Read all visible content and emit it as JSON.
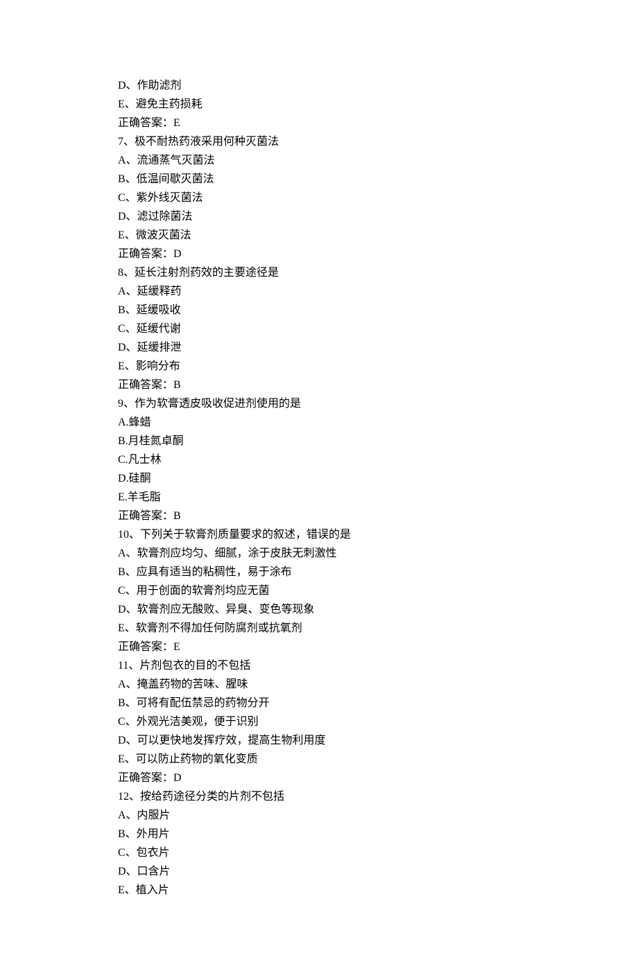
{
  "lines": [
    "D、作助滤剂",
    "E、避免主药损耗",
    "正确答案：E",
    "7、极不耐热药液采用何种灭菌法",
    "A、流通蒸气灭菌法",
    "B、低温间歇灭菌法",
    "C、紫外线灭菌法",
    "D、滤过除菌法",
    "E、微波灭菌法",
    "正确答案：D",
    "8、延长注射剂药效的主要途径是",
    "A、延缓释药",
    "B、延缓吸收",
    "C、延缓代谢",
    "D、延缓排泄",
    "E、影响分布",
    "正确答案：B",
    "9、作为软膏透皮吸收促进剂使用的是",
    "A.蜂蜡",
    "B.月桂氮卓酮",
    "C.凡士林",
    "D.硅酮",
    "E.羊毛脂",
    "正确答案：B",
    "10、下列关于软膏剂质量要求的叙述，错误的是",
    "A、软膏剂应均匀、细腻，涂于皮肤无刺激性",
    "B、应具有适当的粘稠性，易于涂布",
    "C、用于创面的软膏剂均应无菌",
    "D、软膏剂应无酸败、异臭、变色等现象",
    "E、软膏剂不得加任何防腐剂或抗氧剂",
    "正确答案：E",
    "11、片剂包衣的目的不包括",
    "A、掩盖药物的苦味、腥味",
    "B、可将有配伍禁忌的药物分开",
    "C、外观光洁美观，便于识别",
    "D、可以更快地发挥疗效，提高生物利用度",
    "E、可以防止药物的氧化变质",
    "正确答案：D",
    "12、按给药途径分类的片剂不包括",
    "A、内服片",
    "B、外用片",
    "C、包衣片",
    "D、口含片",
    "E、植入片"
  ]
}
